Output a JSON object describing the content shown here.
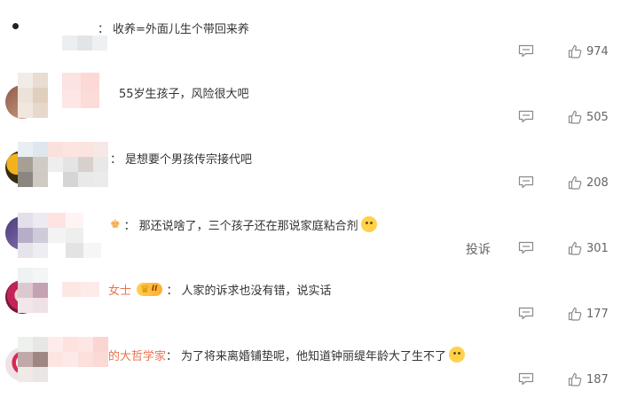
{
  "comments": [
    {
      "username": "",
      "sep": "：",
      "text": "收养=外面儿生个带回来养",
      "likes": "974",
      "emoji": false,
      "badge": "",
      "report": ""
    },
    {
      "username": "",
      "sep": "",
      "text": "55岁生孩子，风险很大吧",
      "likes": "505",
      "emoji": false,
      "badge": "",
      "report": ""
    },
    {
      "username": "",
      "sep": "：",
      "text": "是想要个男孩传宗接代吧",
      "likes": "208",
      "emoji": false,
      "badge": "",
      "report": ""
    },
    {
      "username": "",
      "sep": "：",
      "text": "那还说啥了，三个孩子还在那说家庭粘合剂",
      "likes": "301",
      "emoji": true,
      "badge": "",
      "report": "投诉"
    },
    {
      "username": "女士",
      "sep": "：",
      "text": "人家的诉求也没有错，说实话",
      "likes": "177",
      "emoji": false,
      "badge": "II",
      "report": ""
    },
    {
      "username": "的大哲学家",
      "sep": "：",
      "text": "为了将来离婚铺垫呢，他知道钟丽缇年龄大了生不了",
      "likes": "187",
      "emoji": true,
      "badge": "",
      "report": ""
    }
  ],
  "icons": {
    "reply": "comment-bubble-icon",
    "like": "thumbs-up-icon",
    "badge": "crown-icon",
    "emoji": "emoji-face-icon"
  },
  "colors": {
    "username": "#eb7350",
    "text": "#333333",
    "muted": "#666666"
  }
}
